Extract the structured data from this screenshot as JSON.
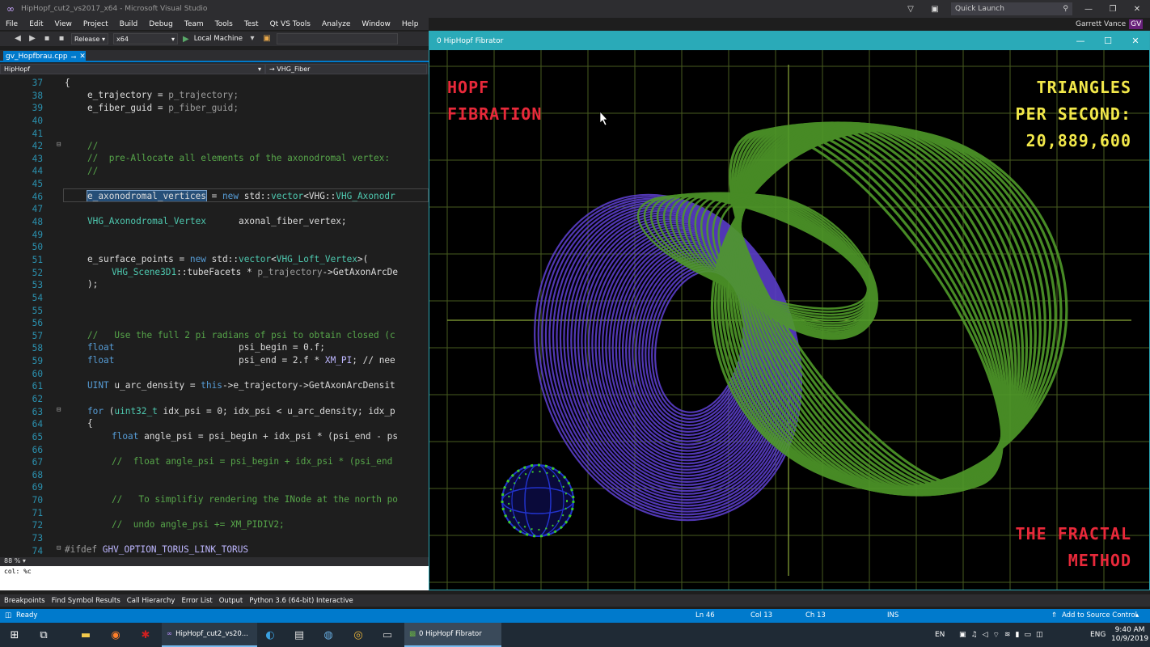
{
  "ide": {
    "window_title": "HipHopf_cut2_vs2017_x64 - Microsoft Visual Studio",
    "quick_launch_placeholder": "Quick Launch",
    "user_name": "Garrett Vance",
    "user_initials": "GV",
    "menu": [
      "File",
      "Edit",
      "View",
      "Project",
      "Build",
      "Debug",
      "Team",
      "Tools",
      "Test",
      "Qt VS Tools",
      "Analyze",
      "Window",
      "Help"
    ],
    "toolbar": {
      "configuration": "Release",
      "platform": "x64",
      "run_target": "Local Machine"
    },
    "doc_tab": "gv_Hopfbrau.cpp",
    "nav_project": "HipHopf",
    "nav_scope": "VHG_Fiber",
    "zoom": "88 %",
    "output_text": "col: %c",
    "tool_windows": [
      "Breakpoints",
      "Find Symbol Results",
      "Call Hierarchy",
      "Error List",
      "Output",
      "Python 3.6 (64-bit) Interactive"
    ],
    "status": {
      "state": "Ready",
      "ln": "Ln 46",
      "col": "Col 13",
      "ch": "Ch 13",
      "mode": "INS",
      "source_control": "Add to Source Control"
    }
  },
  "code": {
    "line_numbers": [
      "37",
      "38",
      "39",
      "40",
      "41",
      "42",
      "43",
      "44",
      "45",
      "46",
      "47",
      "48",
      "49",
      "50",
      "51",
      "52",
      "53",
      "54",
      "55",
      "56",
      "57",
      "58",
      "59",
      "60",
      "61",
      "62",
      "63",
      "64",
      "65",
      "66",
      "67",
      "68",
      "69",
      "70",
      "71",
      "72",
      "73",
      "74"
    ],
    "l37": "{",
    "l38a": "e_trajectory = ",
    "l38b": "p_trajectory;",
    "l39a": "e_fiber_guid = ",
    "l39b": "p_fiber_guid;",
    "l42": "//",
    "l43": "//  pre-Allocate all elements of the axonodromal vertex:",
    "l44": "//",
    "l46a": "e_axonodromal_vertices",
    "l46b": " = ",
    "l46c": "new",
    "l46d": " std::",
    "l46e": "vector",
    "l46f": "<VHG::",
    "l46g": "VHG_Axonodr",
    "l48a": "VHG_Axonodromal_Vertex",
    "l48b": "      axonal_fiber_vertex;",
    "l51a": "e_surface_points = ",
    "l51b": "new",
    "l51c": " std::",
    "l51d": "vector",
    "l51e": "<",
    "l51f": "VHG_Loft_Vertex",
    "l51g": ">(",
    "l52a": "VHG_Scene3D1",
    "l52b": "::tubeFacets * ",
    "l52c": "p_trajectory",
    "l52d": "->GetAxonArcDe",
    "l53": ");",
    "l57": "//   Use the full 2 pi radians of psi to obtain closed (c",
    "l58a": "float",
    "l58b": "                       psi_begin = 0.f;",
    "l59a": "float",
    "l59b": "                       psi_end = 2.f * ",
    "l59c": "XM_PI",
    "l59d": "; // nee",
    "l61a": "UINT",
    "l61b": " u_arc_density = ",
    "l61c": "this",
    "l61d": "->e_trajectory->GetAxonArcDensit",
    "l63a": "for",
    "l63b": " (",
    "l63c": "uint32_t",
    "l63d": " idx_psi = 0; idx_psi < u_arc_density; idx_p",
    "l64": "{",
    "l65a": "float",
    "l65b": " angle_psi = psi_begin + idx_psi * (psi_end - ps",
    "l67": "//  float angle_psi = psi_begin + idx_psi * (psi_end",
    "l70": "//   To simplifiy rendering the INode at the north po",
    "l72": "//  undo angle_psi += XM_PIDIV2;",
    "l74a": "#ifdef ",
    "l74b": "GHV_OPTION_TORUS_LINK_TORUS"
  },
  "fibrator": {
    "window_title": "0 HipHopf Fibrator",
    "overlay_top_left_1": "HOPF",
    "overlay_top_left_2": "FIBRATION",
    "overlay_top_right_1": "TRIANGLES",
    "overlay_top_right_2": "PER SECOND:",
    "overlay_top_right_3": "20,889,600",
    "overlay_bottom_right_1": "THE FRACTAL",
    "overlay_bottom_right_2": "METHOD",
    "colors": {
      "title_bar": "#2aaab8",
      "overlay_red": "#e8293a",
      "overlay_yellow": "#f2e84a",
      "grid": "#5f7a2a",
      "purple_torus": "#5a3ec8",
      "green_fibers": "#4f9a2a"
    }
  },
  "taskbar": {
    "vs_app": "HipHopf_cut2_vs20...",
    "fibrator_app": "0 HipHopf Fibrator",
    "lang1": "EN",
    "lang2": "ENG",
    "time": "9:40 AM",
    "date": "10/9/2019"
  }
}
